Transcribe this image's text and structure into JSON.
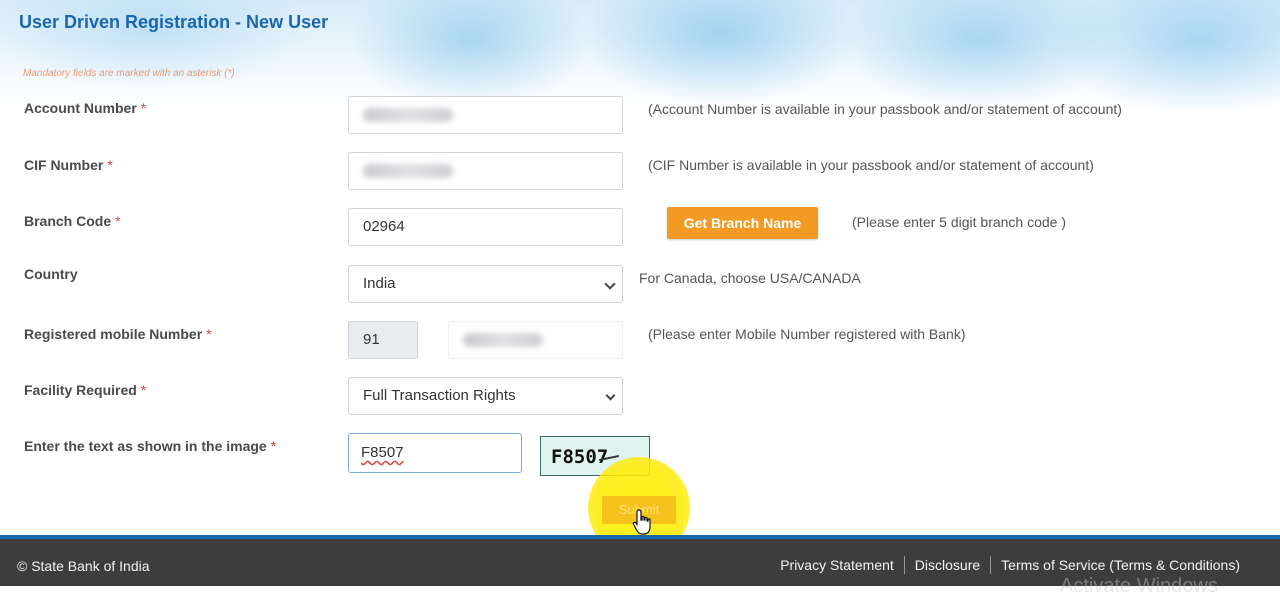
{
  "page": {
    "title": "User Driven Registration - New User",
    "mandatory_note": "Mandatory fields are marked with an asterisk (*)"
  },
  "form": {
    "account_number": {
      "label": "Account Number",
      "required_mark": "*",
      "hint": "(Account Number is available in your passbook and/or statement of account)"
    },
    "cif_number": {
      "label": "CIF Number",
      "required_mark": "*",
      "hint": "(CIF Number is available in your passbook and/or statement of account)"
    },
    "branch_code": {
      "label": "Branch Code",
      "required_mark": "*",
      "value": "02964",
      "button_label": "Get Branch Name",
      "hint": "(Please enter 5 digit branch code )"
    },
    "country": {
      "label": "Country",
      "selected": "India",
      "hint": "For Canada, choose USA/CANADA"
    },
    "mobile": {
      "label": "Registered mobile Number",
      "required_mark": "*",
      "country_code": "91",
      "hint": "(Please enter Mobile Number registered with Bank)"
    },
    "facility": {
      "label": "Facility Required",
      "required_mark": "*",
      "selected": "Full Transaction Rights"
    },
    "captcha": {
      "label": "Enter the text as shown in the image",
      "required_mark": "*",
      "value": "F8507",
      "image_text": "F8507"
    },
    "submit_label": "Submit"
  },
  "footer": {
    "copyright": "© State Bank of India",
    "links": [
      "Privacy Statement",
      "Disclosure",
      "Terms of Service (Terms & Conditions)"
    ]
  },
  "overlay": {
    "watermark": "Activate Windows"
  },
  "colors": {
    "title_blue": "#1a67b0",
    "accent_orange": "#f39a24",
    "footer_bg": "#3d3d3d",
    "required_red": "#e0403a"
  }
}
